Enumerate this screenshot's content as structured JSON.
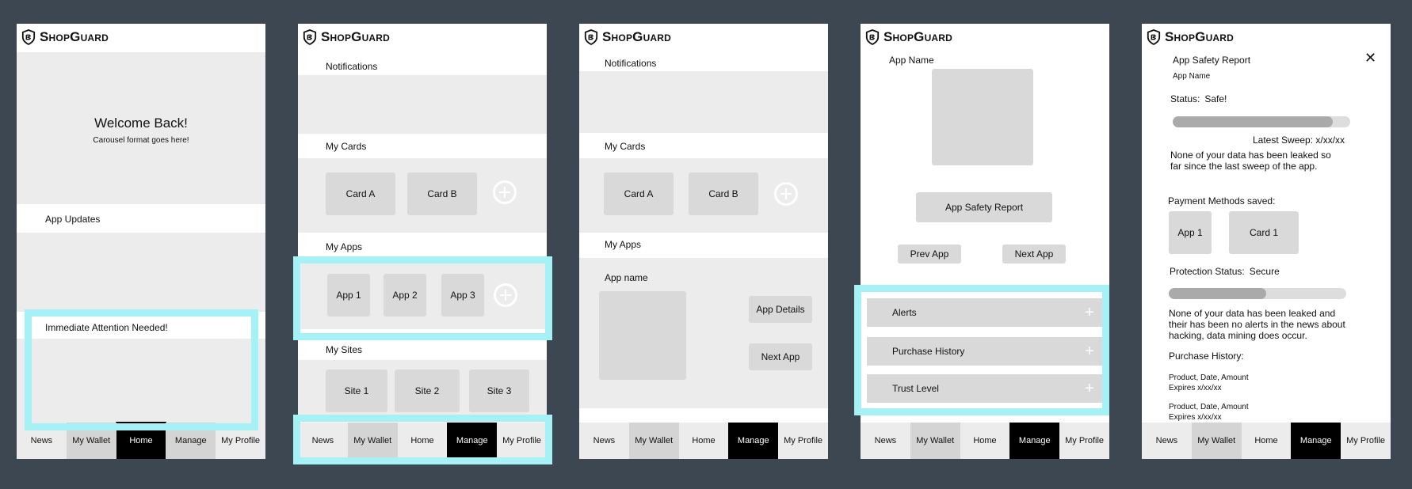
{
  "brand": "ShopGuard",
  "nav": [
    "News",
    "My Wallet",
    "Home",
    "Manage",
    "My Profile"
  ],
  "screen1": {
    "welcome": "Welcome Back!",
    "carousel_note": "Carousel format goes here!",
    "app_updates": "App Updates",
    "attention": "Immediate Attention Needed!"
  },
  "screen2": {
    "notifications": "Notifications",
    "my_cards": "My Cards",
    "cards": [
      "Card A",
      "Card B"
    ],
    "my_apps": "My Apps",
    "apps": [
      "App 1",
      "App 2",
      "App 3"
    ],
    "my_sites": "My Sites",
    "sites": [
      "Site 1",
      "Site 2",
      "Site 3"
    ]
  },
  "screen3": {
    "notifications": "Notifications",
    "my_cards": "My Cards",
    "cards": [
      "Card A",
      "Card B"
    ],
    "my_apps": "My Apps",
    "app_name": "App name",
    "app_details": "App Details",
    "next_app": "Next App"
  },
  "screen4": {
    "app_name": "App Name",
    "safety_report": "App Safety Report",
    "prev_app": "Prev App",
    "next_app": "Next App",
    "sections": [
      "Alerts",
      "Purchase History",
      "Trust Level"
    ]
  },
  "screen5": {
    "title": "App Safety Report",
    "app_name": "App Name",
    "status_label": "Status:",
    "status_value": "Safe!",
    "sweep_progress": 0.9,
    "latest_sweep": "Latest Sweep: x/xx/xx",
    "no_leak_text": "None of your data has been leaked so far since the last sweep of the app.",
    "payment_methods": "Payment Methods saved:",
    "payments": [
      "App 1",
      "Card 1"
    ],
    "protection_label": "Protection Status:",
    "protection_value": "Secure",
    "protection_progress": 0.55,
    "protection_text": "None of your data has been leaked and their has been no alerts in the news about hacking, data mining does occur.",
    "purchase_history": "Purchase History:",
    "purchases": [
      {
        "line1": "Product, Date, Amount",
        "line2": "Expires x/xx/xx"
      },
      {
        "line1": "Product, Date, Amount",
        "line2": "Expires x/xx/xx"
      }
    ]
  },
  "active_tabs": {
    "screen1": "Home",
    "screen2": "Manage",
    "screen3": "Manage",
    "screen4": "Manage",
    "screen5": "Manage"
  },
  "colors": {
    "background": "#3d4752",
    "highlight": "#a4f2f5",
    "panel": "#ececec",
    "button": "#d9d9d9"
  },
  "icons": {
    "logo": "shield-icon",
    "add": "plus-circle-icon",
    "close": "close-icon",
    "expand": "plus-icon"
  }
}
